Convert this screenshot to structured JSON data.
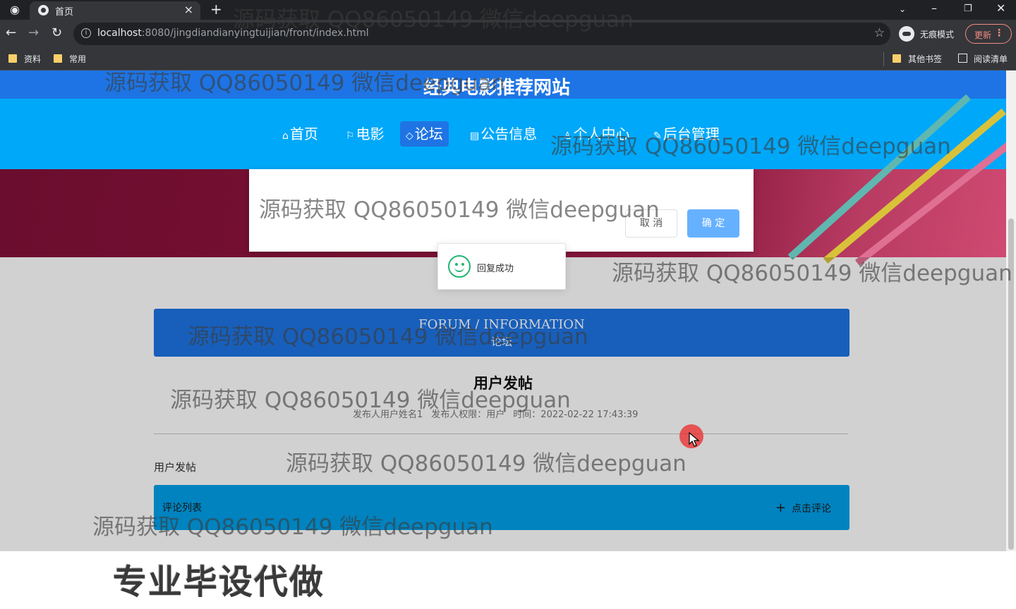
{
  "browser": {
    "tab_title": "首页",
    "url_host": "localhost",
    "url_path": ":8080/jingdiandianyingtuijian/front/index.html",
    "incognito_label": "无痕模式",
    "update_label": "更新",
    "bookmarks": [
      "资料",
      "常用"
    ],
    "other_bookmarks": "其他书签",
    "reading_list": "阅读清单"
  },
  "site": {
    "title": "经典电影推荐网站",
    "nav": [
      {
        "label": "首页",
        "icon": "home-icon"
      },
      {
        "label": "电影",
        "icon": "flag-icon"
      },
      {
        "label": "论坛",
        "icon": "tag-icon",
        "active": true
      },
      {
        "label": "公告信息",
        "icon": "notice-icon"
      },
      {
        "label": "个人中心",
        "icon": "user-icon"
      },
      {
        "label": "后台管理",
        "icon": "wrench-icon"
      }
    ]
  },
  "modal": {
    "cancel_label": "取 消",
    "ok_label": "确 定"
  },
  "toast": {
    "message": "回复成功"
  },
  "forum": {
    "section_en": "FORUM / INFORMATION",
    "section_cn": "论坛",
    "post_title": "用户发帖",
    "meta": {
      "author": "发布人用户姓名1",
      "role": "发布人权限：用户",
      "time": "时间：2022-02-22 17:43:39"
    },
    "post_body": "用户发帖",
    "comment_title": "评论列表",
    "comment_button": "点击评论"
  },
  "watermark": "源码获取 QQ86050149 微信deepguan",
  "caption": "专业毕设代做",
  "colors": {
    "title_bar": "#1e74e4",
    "nav_bar": "#00a8f9",
    "confirm_button": "#66b1ff",
    "success_icon": "#22b573"
  }
}
